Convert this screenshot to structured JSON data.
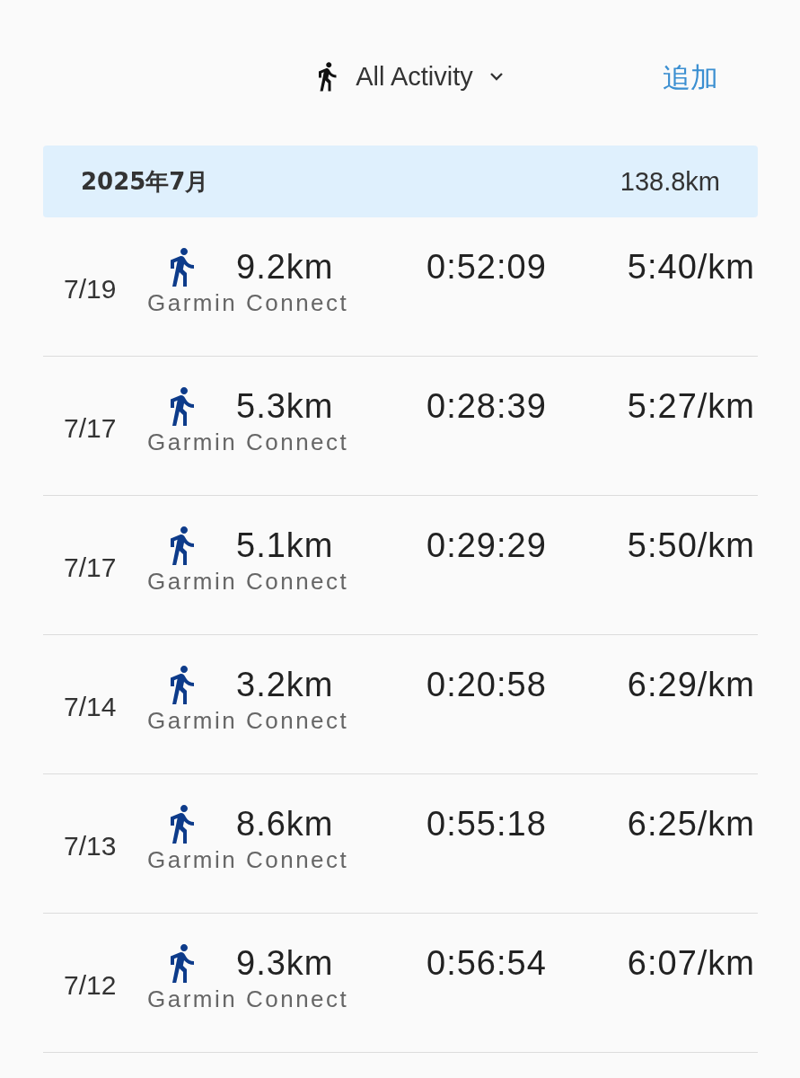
{
  "header": {
    "filter_label": "All Activity",
    "add_label": "追加"
  },
  "month": {
    "label": "2025年7月",
    "total": "138.8km"
  },
  "activities": [
    {
      "date": "7/19",
      "distance": "9.2km",
      "duration": "0:52:09",
      "pace": "5:40/km",
      "source": "Garmin Connect"
    },
    {
      "date": "7/17",
      "distance": "5.3km",
      "duration": "0:28:39",
      "pace": "5:27/km",
      "source": "Garmin Connect"
    },
    {
      "date": "7/17",
      "distance": "5.1km",
      "duration": "0:29:29",
      "pace": "5:50/km",
      "source": "Garmin Connect"
    },
    {
      "date": "7/14",
      "distance": "3.2km",
      "duration": "0:20:58",
      "pace": "6:29/km",
      "source": "Garmin Connect"
    },
    {
      "date": "7/13",
      "distance": "8.6km",
      "duration": "0:55:18",
      "pace": "6:25/km",
      "source": "Garmin Connect"
    },
    {
      "date": "7/12",
      "distance": "9.3km",
      "duration": "0:56:54",
      "pace": "6:07/km",
      "source": "Garmin Connect"
    }
  ]
}
